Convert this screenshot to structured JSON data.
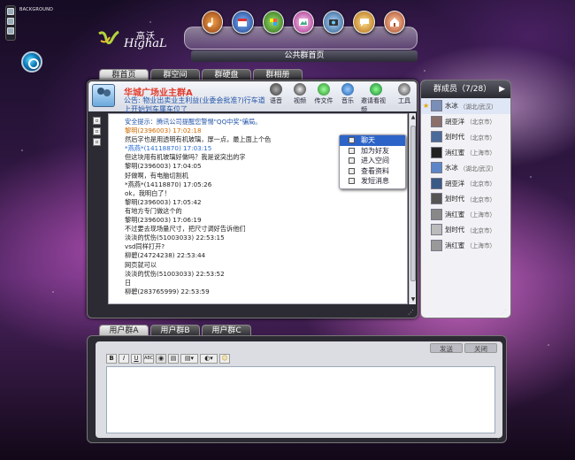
{
  "top": {
    "bg_label": "BACKGROUND",
    "logo_cn": "高沃",
    "logo_en": "HighaL",
    "page_title": "公共群首页",
    "dock_icons": [
      "music-icon",
      "calendar-icon",
      "puzzle-icon",
      "photo-icon",
      "camera-icon",
      "chat-icon",
      "home-icon"
    ]
  },
  "tabs": {
    "items": [
      "群首页",
      "群空间",
      "群硬盘",
      "群相册"
    ],
    "active": 0
  },
  "group": {
    "name": "华城广场业主群A",
    "notice": "公告: 物业出卖业主利益(业委会批准?)行车道上开始划车属车位了"
  },
  "tools": [
    {
      "label": "语音",
      "icon": "microphone-icon",
      "color": "#444"
    },
    {
      "label": "视频",
      "icon": "webcam-icon",
      "color": "#333"
    },
    {
      "label": "传文件",
      "icon": "upload-icon",
      "color": "#3a9a3a"
    },
    {
      "label": "音乐",
      "icon": "music-globe-icon",
      "color": "#2f78c8"
    },
    {
      "label": "邀请看视频",
      "icon": "invite-video-icon",
      "color": "#2c9a44"
    },
    {
      "label": "工具",
      "icon": "gear-icon",
      "color": "#555"
    }
  ],
  "messages": [
    {
      "text": "安全提示：腾讯公司提醒您警惕\"QQ中奖\"骗局。",
      "style": "notice"
    },
    {
      "text": "黎明(2396003) 17:02:18",
      "style": "orange"
    },
    {
      "text": "然后字也是用透明有机玻璃，厚一点，最上面上个色",
      "style": "plain"
    },
    {
      "text": "*燕燕*(14118870) 17:03:15",
      "style": "blue"
    },
    {
      "text": "但这块用有机玻璃好做吗？我是说突出的字",
      "style": "plain"
    },
    {
      "text": "黎明(2396003) 17:04:05",
      "style": "plain"
    },
    {
      "text": "好做啊，有电脑切割机",
      "style": "plain"
    },
    {
      "text": "*燕燕*(14118870) 17:05:26",
      "style": "plain"
    },
    {
      "text": "ok，我明白了！",
      "style": "plain"
    },
    {
      "text": "黎明(2396003) 17:05:42",
      "style": "plain"
    },
    {
      "text": "有地方专门做这个的",
      "style": "plain"
    },
    {
      "text": "黎明(2396003) 17:06:19",
      "style": "plain"
    },
    {
      "text": "不过要去现场量尺寸，把尺寸调好告诉他们",
      "style": "plain"
    },
    {
      "text": "淡淡的忧伤(51003033) 22:53:15",
      "style": "plain"
    },
    {
      "text": "vsd同样打开?",
      "style": "plain"
    },
    {
      "text": "柳碧(24724238) 22:53:44",
      "style": "plain"
    },
    {
      "text": "网页就可以",
      "style": "plain"
    },
    {
      "text": "淡淡的忧伤(51003033) 22:53:52",
      "style": "plain"
    },
    {
      "text": "日",
      "style": "plain"
    },
    {
      "text": "柳碧(283765999) 22:53:59",
      "style": "plain"
    }
  ],
  "context_menu": {
    "items": [
      "聊天",
      "加为好友",
      "进入空间",
      "查看资料",
      "发短消息"
    ],
    "active": 0
  },
  "members": {
    "title": "群成员（7/28）",
    "list": [
      {
        "name": "水冰",
        "loc": "（湖北/武汉）",
        "color": "#7a8fb8",
        "star": true,
        "selected": true
      },
      {
        "name": "胡亚洋",
        "loc": "（北京市）",
        "color": "#8a6f6a",
        "star": false,
        "selected": false
      },
      {
        "name": "划时代",
        "loc": "（北京市）",
        "color": "#4a6a9a",
        "star": false,
        "selected": false
      },
      {
        "name": "消红蜜",
        "loc": "（上海市）",
        "color": "#222",
        "star": false,
        "selected": false
      },
      {
        "name": "水冰",
        "loc": "（湖北/武汉）",
        "color": "#5c86c8",
        "star": false,
        "selected": false
      },
      {
        "name": "胡亚洋",
        "loc": "（北京市）",
        "color": "#3a5a86",
        "star": false,
        "selected": false
      },
      {
        "name": "划时代",
        "loc": "（北京市）",
        "color": "#555",
        "star": false,
        "selected": false
      },
      {
        "name": "消红蜜",
        "loc": "（上海市）",
        "color": "#888",
        "star": false,
        "selected": false
      },
      {
        "name": "划时代",
        "loc": "（北京市）",
        "color": "#bbb",
        "star": false,
        "selected": false
      },
      {
        "name": "消红蜜",
        "loc": "（上海市）",
        "color": "#999",
        "star": false,
        "selected": false
      }
    ]
  },
  "bottom_tabs": {
    "items": [
      "用户群A",
      "用户群B",
      "用户群C"
    ],
    "active": 0
  },
  "compose": {
    "send_label": "发送",
    "close_label": "关闭",
    "toolbar": [
      "B",
      "I",
      "U",
      "ABC"
    ]
  }
}
